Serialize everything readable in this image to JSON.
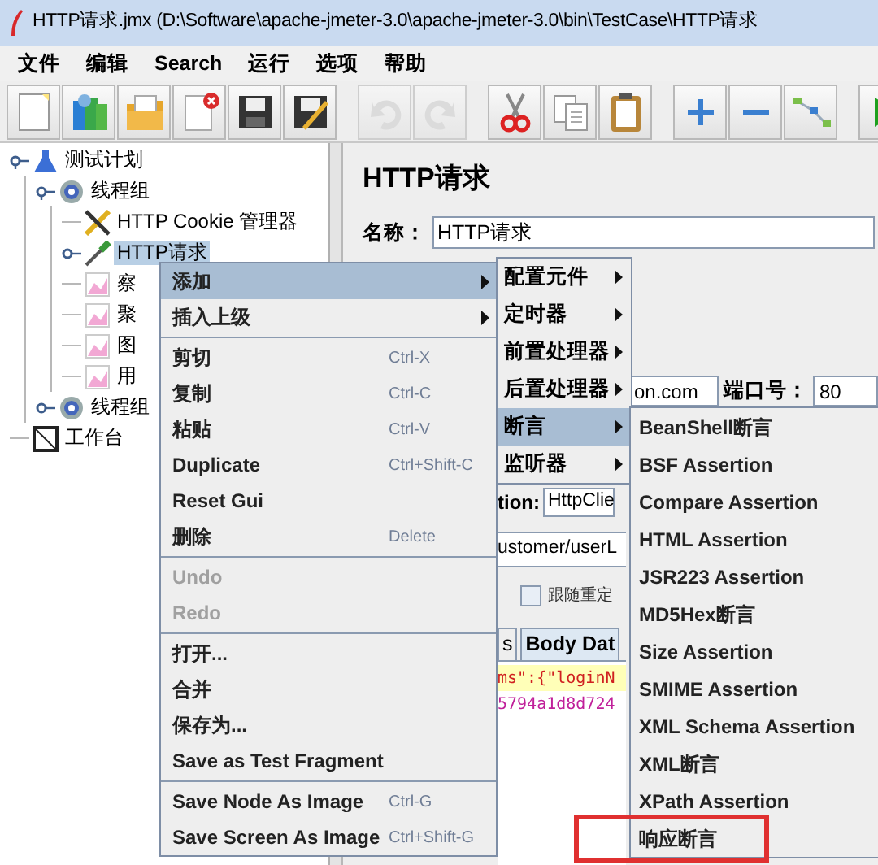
{
  "window": {
    "title": "HTTP请求.jmx (D:\\Software\\apache-jmeter-3.0\\apache-jmeter-3.0\\bin\\TestCase\\HTTP请求"
  },
  "menubar": [
    "文件",
    "编辑",
    "Search",
    "运行",
    "选项",
    "帮助"
  ],
  "toolbar": [
    {
      "kind": "new",
      "disabled": false
    },
    {
      "kind": "templates",
      "disabled": false
    },
    {
      "kind": "open",
      "disabled": false
    },
    {
      "kind": "close",
      "disabled": false
    },
    {
      "kind": "save",
      "disabled": false
    },
    {
      "kind": "saveas",
      "disabled": false
    },
    {
      "kind": "undo",
      "disabled": true
    },
    {
      "kind": "redo",
      "disabled": true
    },
    {
      "kind": "cut",
      "disabled": false
    },
    {
      "kind": "copy",
      "disabled": false
    },
    {
      "kind": "paste",
      "disabled": false
    },
    {
      "kind": "expand",
      "disabled": false
    },
    {
      "kind": "collapse",
      "disabled": false
    },
    {
      "kind": "toggle",
      "disabled": false
    },
    {
      "kind": "start",
      "disabled": false
    }
  ],
  "tree": [
    {
      "label": "测试计划",
      "kind": "plan",
      "selected": false,
      "expanded": true,
      "children": [
        {
          "label": "线程组",
          "kind": "threads",
          "selected": false,
          "expanded": true,
          "children": [
            {
              "label": "HTTP Cookie 管理器",
              "kind": "config",
              "selected": false
            },
            {
              "label": "HTTP请求",
              "kind": "sampler",
              "selected": true,
              "expanded": false
            },
            {
              "label": "察",
              "kind": "listener",
              "selected": false
            },
            {
              "label": "聚",
              "kind": "listener",
              "selected": false
            },
            {
              "label": "图",
              "kind": "listener",
              "selected": false
            },
            {
              "label": "用",
              "kind": "listener",
              "selected": false
            }
          ]
        },
        {
          "label": "线程组",
          "kind": "threads",
          "selected": false,
          "expanded": false
        }
      ]
    },
    {
      "label": "工作台",
      "kind": "workbench",
      "selected": false
    }
  ],
  "editor": {
    "title": "HTTP请求",
    "name_label": "名称：",
    "name_value": "HTTP请求",
    "server_value": "on.com",
    "port_label": "端口号：",
    "port_value": "80",
    "impl_label": "tion:",
    "impl_value": "HttpClie",
    "path_value": "ustomer/userL",
    "redirect_label": "跟随重定",
    "redirect_checked": false,
    "tabs": [
      {
        "label": "s",
        "selected": false
      },
      {
        "label": "Body Dat",
        "selected": true
      }
    ],
    "body_lines": [
      {
        "text": "ms\":{\"loginN",
        "current": true
      },
      {
        "text": "5794a1d8d724",
        "current": false
      }
    ]
  },
  "context_menu": [
    {
      "kind": "item",
      "label": "添加",
      "submenu": true,
      "selected": true,
      "disabled": false
    },
    {
      "kind": "item",
      "label": "插入上级",
      "submenu": true,
      "selected": false,
      "disabled": false
    },
    {
      "kind": "separator"
    },
    {
      "kind": "item",
      "label": "剪切",
      "shortcut": "Ctrl-X",
      "selected": false,
      "disabled": false
    },
    {
      "kind": "item",
      "label": "复制",
      "shortcut": "Ctrl-C",
      "selected": false,
      "disabled": false
    },
    {
      "kind": "item",
      "label": "粘贴",
      "shortcut": "Ctrl-V",
      "selected": false,
      "disabled": false
    },
    {
      "kind": "item",
      "label": "Duplicate",
      "shortcut": "Ctrl+Shift-C",
      "selected": false,
      "disabled": false
    },
    {
      "kind": "item",
      "label": "Reset Gui",
      "selected": false,
      "disabled": false
    },
    {
      "kind": "item",
      "label": "删除",
      "shortcut": "Delete",
      "selected": false,
      "disabled": false
    },
    {
      "kind": "separator"
    },
    {
      "kind": "item",
      "label": "Undo",
      "selected": false,
      "disabled": true
    },
    {
      "kind": "item",
      "label": "Redo",
      "selected": false,
      "disabled": true
    },
    {
      "kind": "separator"
    },
    {
      "kind": "item",
      "label": "打开...",
      "selected": false,
      "disabled": false
    },
    {
      "kind": "item",
      "label": "合并",
      "selected": false,
      "disabled": false
    },
    {
      "kind": "item",
      "label": "保存为...",
      "selected": false,
      "disabled": false
    },
    {
      "kind": "item",
      "label": "Save as Test Fragment",
      "selected": false,
      "disabled": false
    },
    {
      "kind": "separator"
    },
    {
      "kind": "item",
      "label": "Save Node As Image",
      "shortcut": "Ctrl-G",
      "selected": false,
      "disabled": false
    },
    {
      "kind": "item",
      "label": "Save Screen As Image",
      "shortcut": "Ctrl+Shift-G",
      "selected": false,
      "disabled": false
    }
  ],
  "add_submenu": [
    {
      "label": "配置元件",
      "selected": false
    },
    {
      "label": "定时器",
      "selected": false
    },
    {
      "label": "前置处理器",
      "selected": false
    },
    {
      "label": "后置处理器",
      "selected": false
    },
    {
      "label": "断言",
      "selected": true
    },
    {
      "label": "监听器",
      "selected": false
    }
  ],
  "assertion_submenu": [
    {
      "label": "BeanShell断言",
      "highlighted": false
    },
    {
      "label": "BSF Assertion",
      "highlighted": false
    },
    {
      "label": "Compare Assertion",
      "highlighted": false
    },
    {
      "label": "HTML Assertion",
      "highlighted": false
    },
    {
      "label": "JSR223 Assertion",
      "highlighted": false
    },
    {
      "label": "MD5Hex断言",
      "highlighted": false
    },
    {
      "label": "Size Assertion",
      "highlighted": false
    },
    {
      "label": "SMIME Assertion",
      "highlighted": false
    },
    {
      "label": "XML Schema Assertion",
      "highlighted": false
    },
    {
      "label": "XML断言",
      "highlighted": false
    },
    {
      "label": "XPath Assertion",
      "highlighted": false
    },
    {
      "label": "响应断言",
      "highlighted": true
    }
  ]
}
